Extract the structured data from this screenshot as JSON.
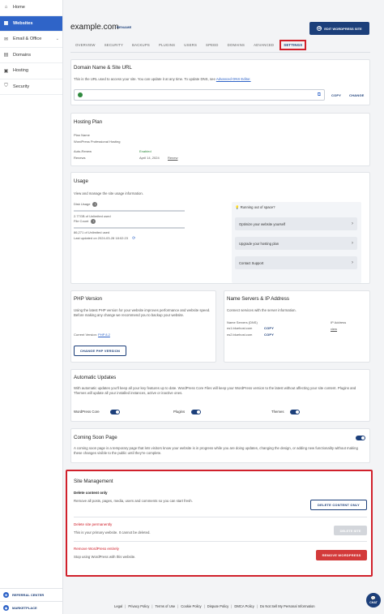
{
  "sidebar": {
    "items": [
      {
        "label": "Home",
        "icon": "home-icon"
      },
      {
        "label": "Websites",
        "icon": "websites-icon"
      },
      {
        "label": "Email & Office",
        "icon": "email-icon"
      },
      {
        "label": "Domains",
        "icon": "domains-icon"
      },
      {
        "label": "Hosting",
        "icon": "hosting-icon"
      },
      {
        "label": "Security",
        "icon": "shield-icon"
      }
    ],
    "bottom": [
      {
        "label": "REFERRAL CENTER"
      },
      {
        "label": "MARKETPLACE"
      }
    ]
  },
  "header": {
    "site_title": "example.com",
    "rename": "RENAME",
    "edit_button": "EDIT WORDPRESS SITE"
  },
  "tabs": [
    {
      "label": "OVERVIEW"
    },
    {
      "label": "SECURITY"
    },
    {
      "label": "BACKUPS"
    },
    {
      "label": "PLUGINS"
    },
    {
      "label": "USERS"
    },
    {
      "label": "SPEED"
    },
    {
      "label": "DOMAINS"
    },
    {
      "label": "ADVANCED"
    },
    {
      "label": "SETTINGS"
    }
  ],
  "domain_card": {
    "title": "Domain Name & Site URL",
    "desc": "This is the URL used to access your site. You can update it at any time. To update DNS, see",
    "desc_link": "Advanced DNS Editor.",
    "copy": "COPY",
    "change": "CHANGE"
  },
  "hosting_card": {
    "title": "Hosting Plan",
    "plan_name_label": "Plan Name",
    "plan_name": "WordPress Professional Hosting",
    "auto_renew_label": "Auto-Renew",
    "auto_renew_value": "Enabled",
    "renews_label": "Renews",
    "renews_value": "April 14, 2024",
    "renew_link": "Renew"
  },
  "usage_card": {
    "title": "Usage",
    "desc": "View and manage the site usage information.",
    "disk_label": "Disk Usage",
    "disk_value": "2.77GB of Unlimited used",
    "file_label": "File Count",
    "file_value": "86,271 of Unlimited used",
    "last_updated": "Last updated on 2024-03-28 18:02:23",
    "promo_title": "Running out of space?",
    "promo_items": [
      {
        "label": "Optimize your website yourself"
      },
      {
        "label": "Upgrade your hosting plan"
      },
      {
        "label": "Contact Support"
      }
    ]
  },
  "php_card": {
    "title": "PHP Version",
    "desc": "Using the latest PHP version for your website improves performance and website speed. Before making any change we recommend you to backup your website.",
    "current_label": "Current Version:",
    "current_value": "PHP 8.2",
    "button": "CHANGE PHP VERSION"
  },
  "ns_card": {
    "title": "Name Servers & IP Address",
    "desc": "Connect services with the server information.",
    "ns_label": "Name Servers (DNS)",
    "ns1": "ns1.bluehost.com",
    "ns2": "ns2.bluehost.com",
    "copy": "COPY",
    "ip_label": "IP Address",
    "ip_link": "view"
  },
  "auto_updates": {
    "title": "Automatic Updates",
    "desc": "With automatic updates you'll keep all your key features up to date. WordPress Core Files will keep your WordPress version to the latest without affecting your site content. Plugins and Themes will update all your installed instances, active or inactive ones.",
    "toggles": [
      {
        "label": "WordPress Core"
      },
      {
        "label": "Plugins"
      },
      {
        "label": "Themes"
      }
    ]
  },
  "coming_soon": {
    "title": "Coming Soon Page",
    "desc": "A coming soon page is a temporary page that lets visitors know your website is in progress while you are doing updates, changing the design, or adding new functionality without making these changes visible to the public until they're complete."
  },
  "site_management": {
    "title": "Site Management",
    "delete_content_title": "Delete content only",
    "delete_content_desc": "Remove all posts, pages, media, users and comments so you can start fresh.",
    "delete_content_button": "DELETE CONTENT ONLY",
    "delete_site_title": "Delete site permanently",
    "delete_site_desc": "This is your primary website. It cannot be deleted.",
    "delete_site_button": "DELETE SITE",
    "remove_wp_title": "Remove WordPress entirely",
    "remove_wp_desc": "Stop using WordPress with this website.",
    "remove_wp_button": "REMOVE WORDPRESS"
  },
  "footer": {
    "links": [
      {
        "label": "Legal"
      },
      {
        "label": "Privacy Policy"
      },
      {
        "label": "Terms of Use"
      },
      {
        "label": "Cookie Policy"
      },
      {
        "label": "Dispute Policy"
      },
      {
        "label": "DMCA Policy"
      },
      {
        "label": "Do Not Sell My Personal Information"
      }
    ]
  },
  "chat": {
    "label": "CHAT"
  }
}
